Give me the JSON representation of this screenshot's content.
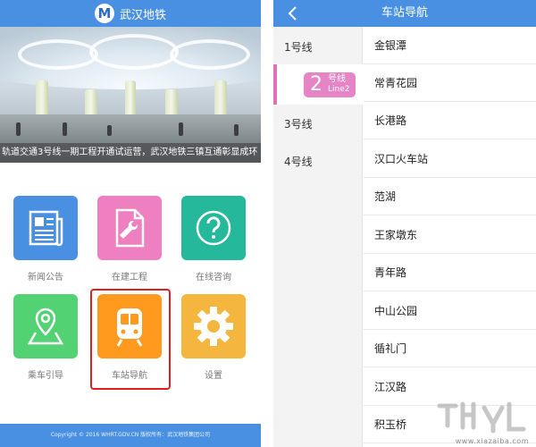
{
  "left_screen": {
    "app_title": "武汉地铁",
    "logo_glyph": "M",
    "banner_caption": "轨道交通3号线一期工程开通试运营，武汉地铁三镇互通彰显成环",
    "tiles": [
      {
        "label": "新闻公告",
        "icon": "newspaper-icon",
        "color": "#4a90e2"
      },
      {
        "label": "在建工程",
        "icon": "document-wrench-icon",
        "color": "#ee7fc0"
      },
      {
        "label": "在线咨询",
        "icon": "question-icon",
        "color": "#26b89a"
      },
      {
        "label": "乘车引导",
        "icon": "map-pin-icon",
        "color": "#52d273"
      },
      {
        "label": "车站导航",
        "icon": "train-icon",
        "color": "#ff9a1f"
      },
      {
        "label": "设置",
        "icon": "gear-icon",
        "color": "#f4b63f"
      }
    ],
    "footer": "Copyright © 2016 WHRT.GDV.CN 版权所有：武汉地铁集团公司"
  },
  "right_screen": {
    "title": "车站导航",
    "lines": [
      {
        "label": "1号线",
        "active": false
      },
      {
        "label": "号线",
        "number": "2",
        "english": "Line2",
        "active": true
      },
      {
        "label": "3号线",
        "active": false
      },
      {
        "label": "4号线",
        "active": false
      }
    ],
    "stations": [
      "金银潭",
      "常青花园",
      "长港路",
      "汉口火车站",
      "范湖",
      "王家墩东",
      "青年路",
      "中山公园",
      "循礼门",
      "江汉路",
      "积玉桥"
    ]
  },
  "watermark": {
    "site": "www.xiazaiba.com"
  },
  "colors": {
    "header_blue": "#4a90e2",
    "line2_pink": "#e585c5",
    "highlight_red": "#e02020"
  }
}
